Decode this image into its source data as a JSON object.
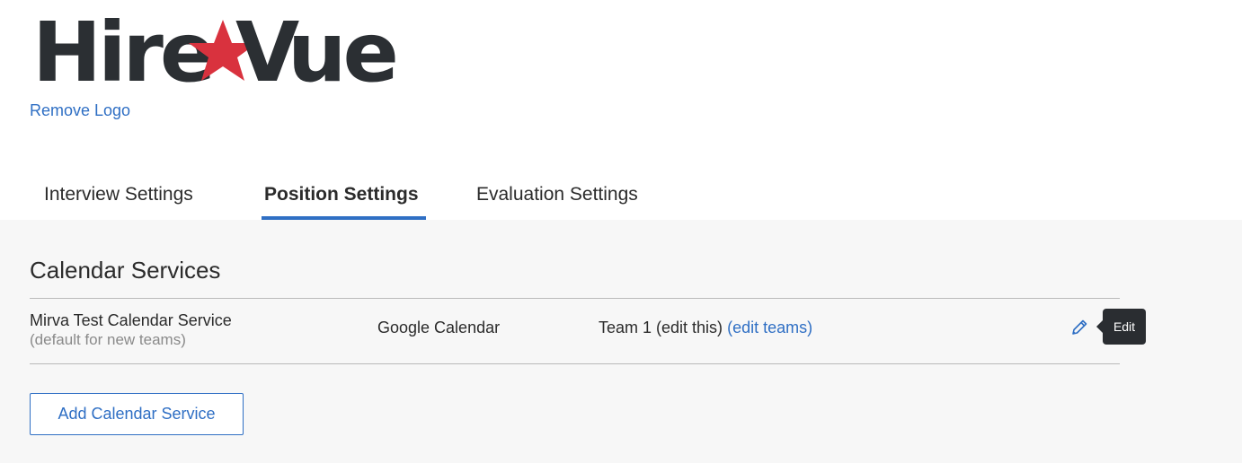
{
  "brand": {
    "logo_text_left": "Hire",
    "logo_text_right": "ue",
    "logo_letter_v": "V",
    "logo_dark_color": "#2b2f33",
    "logo_star_color": "#d9323e",
    "remove_logo_label": "Remove Logo"
  },
  "tabs": [
    {
      "label": "Interview Settings",
      "active": false
    },
    {
      "label": "Position Settings",
      "active": true
    },
    {
      "label": "Evaluation Settings",
      "active": false
    }
  ],
  "calendar_services": {
    "title": "Calendar Services",
    "rows": [
      {
        "name": "Mirva Test Calendar Service",
        "subtitle": "(default for new teams)",
        "provider": "Google Calendar",
        "teams_text": "Team 1 (edit this)",
        "edit_teams_label": "(edit teams)",
        "edit_tooltip": "Edit",
        "edit_icon": "pencil-icon"
      }
    ],
    "add_button_label": "Add Calendar Service"
  },
  "colors": {
    "accent": "#2f6fc4",
    "panel_bg": "#f7f7f7",
    "tooltip_bg": "#2a2d31"
  }
}
